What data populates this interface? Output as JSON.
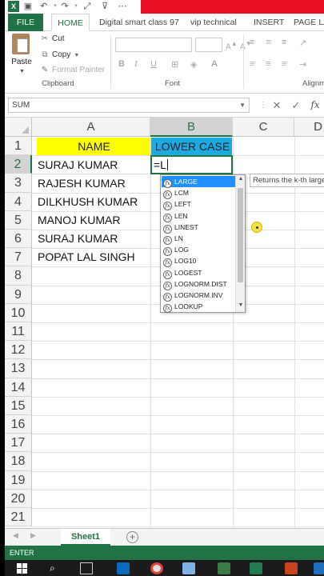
{
  "ribbon_tabs": [
    "FILE",
    "HOME",
    "Digital smart class 97",
    "vip technical",
    "INSERT",
    "PAGE LAY"
  ],
  "clipboard": {
    "paste_label": "Paste",
    "cut_label": "Cut",
    "copy_label": "Copy",
    "format_painter_label": "Format Painter",
    "group_label": "Clipboard"
  },
  "font_group": {
    "bold": "B",
    "italic": "I",
    "underline": "U",
    "group_label": "Font"
  },
  "alignment_group": {
    "group_label": "Alignme"
  },
  "formula_bar": {
    "name_box": "SUM",
    "cancel": "✕",
    "enter": "✓",
    "fx": "fx"
  },
  "columns": [
    "A",
    "B",
    "C",
    "D"
  ],
  "rows": [
    "1",
    "2",
    "3",
    "4",
    "5",
    "6",
    "7",
    "8",
    "9",
    "10",
    "11",
    "12",
    "13",
    "14",
    "15",
    "16",
    "17",
    "18",
    "19",
    "20",
    "21"
  ],
  "cells": {
    "A1": "NAME",
    "B1": "LOWER CASE",
    "A2": "SURAJ KUMAR",
    "A3": "RAJESH KUMAR",
    "A4": "DILKHUSH KUMAR",
    "A5": "MANOJ KUMAR",
    "A6": "SURAJ KUMAR",
    "A7": "POPAT LAL SINGH"
  },
  "active_cell": {
    "ref": "B2",
    "value": "=L"
  },
  "autocomplete": {
    "items": [
      "LARGE",
      "LCM",
      "LEFT",
      "LEN",
      "LINEST",
      "LN",
      "LOG",
      "LOG10",
      "LOGEST",
      "LOGNORM.DIST",
      "LOGNORM.INV",
      "LOOKUP"
    ],
    "selected": "LARGE",
    "tooltip": "Returns the k-th large"
  },
  "sheet_tabs": [
    "Sheet1"
  ],
  "status": {
    "mode": "ENTER"
  },
  "colors": {
    "excel_green": "#217346",
    "header_yellow": "#ffff00",
    "header_blue": "#1ea9e1",
    "selection_blue": "#1e90ff",
    "title_red": "#e81123"
  }
}
